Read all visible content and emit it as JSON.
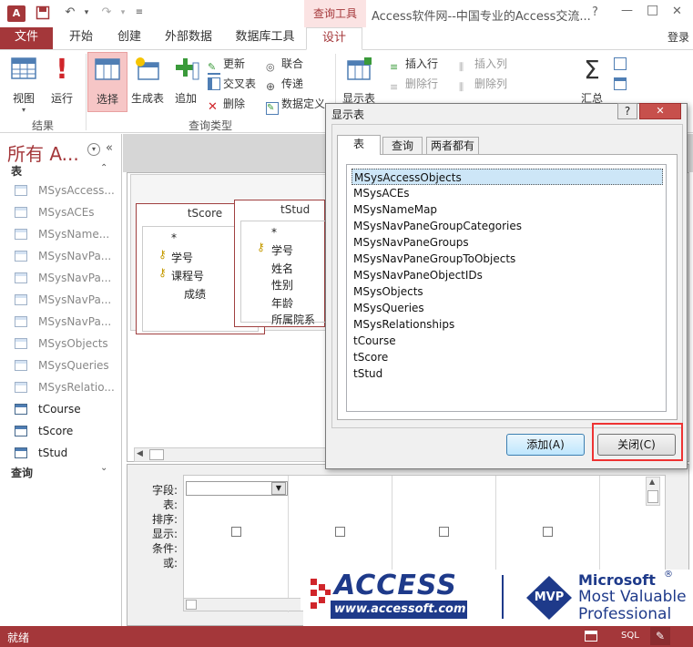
{
  "titlebar": {
    "context_tab": "查询工具",
    "title": "Access软件网--中国专业的Access交流...",
    "help": "?",
    "minimize": "—",
    "restore": "□",
    "close": "✕"
  },
  "tabs": {
    "file": "文件",
    "home": "开始",
    "create": "创建",
    "external": "外部数据",
    "dbtools": "数据库工具",
    "design": "设计",
    "login": "登录"
  },
  "ribbon": {
    "view": "视图",
    "run": "运行",
    "select": "选择",
    "maketable": "生成表",
    "append": "追加",
    "update": "更新",
    "crosstab": "交叉表",
    "delete": "删除",
    "union": "联合",
    "passthrough": "传递",
    "datadef": "数据定义",
    "showtable": "显示表",
    "insertrow": "插入行",
    "deleterow": "删除行",
    "insertcol": "插入列",
    "deletecol": "删除列",
    "totals": "汇总",
    "group_results": "结果",
    "group_querytype": "查询类型"
  },
  "nav": {
    "title": "所有 A...",
    "section_tables": "表",
    "section_queries": "查询",
    "items": [
      {
        "label": "MSysAccess...",
        "dim": true
      },
      {
        "label": "MSysACEs",
        "dim": true
      },
      {
        "label": "MSysName...",
        "dim": true
      },
      {
        "label": "MSysNavPa...",
        "dim": true
      },
      {
        "label": "MSysNavPa...",
        "dim": true
      },
      {
        "label": "MSysNavPa...",
        "dim": true
      },
      {
        "label": "MSysNavPa...",
        "dim": true
      },
      {
        "label": "MSysObjects",
        "dim": true
      },
      {
        "label": "MSysQueries",
        "dim": true
      },
      {
        "label": "MSysRelatio...",
        "dim": true
      },
      {
        "label": "tCourse",
        "dim": false
      },
      {
        "label": "tScore",
        "dim": false
      },
      {
        "label": "tStud",
        "dim": false
      }
    ]
  },
  "tables": {
    "tscore": {
      "title": "tScore",
      "fields": [
        "*",
        "学号",
        "课程号",
        "成绩"
      ]
    },
    "tstud": {
      "title": "tStud",
      "fields": [
        "*",
        "学号",
        "姓名",
        "性别",
        "年龄",
        "所属院系"
      ]
    }
  },
  "grid": {
    "rows": [
      "字段:",
      "表:",
      "排序:",
      "显示:",
      "条件:",
      "或:"
    ]
  },
  "dialog": {
    "title": "显示表",
    "help": "?",
    "close": "✕",
    "tabs": [
      "表",
      "查询",
      "两者都有"
    ],
    "items": [
      "MSysAccessObjects",
      "MSysACEs",
      "MSysNameMap",
      "MSysNavPaneGroupCategories",
      "MSysNavPaneGroups",
      "MSysNavPaneGroupToObjects",
      "MSysNavPaneObjectIDs",
      "MSysObjects",
      "MSysQueries",
      "MSysRelationships",
      "tCourse",
      "tScore",
      "tStud"
    ],
    "selected": 0,
    "add": "添加(A)",
    "closebtn": "关闭(C)"
  },
  "watermark": {
    "brand": "ACCESS",
    "url": "www.accessoft.com",
    "mvp": "MVP",
    "ms": "Microsoft",
    "ms_reg": "®",
    "line1": "Most Valuable",
    "line2": "Professional"
  },
  "status": {
    "text": "就绪",
    "sql": "SQL"
  },
  "colors": {
    "accent": "#a4373a",
    "highlight": "#cde6f7",
    "selection": "#e33"
  }
}
